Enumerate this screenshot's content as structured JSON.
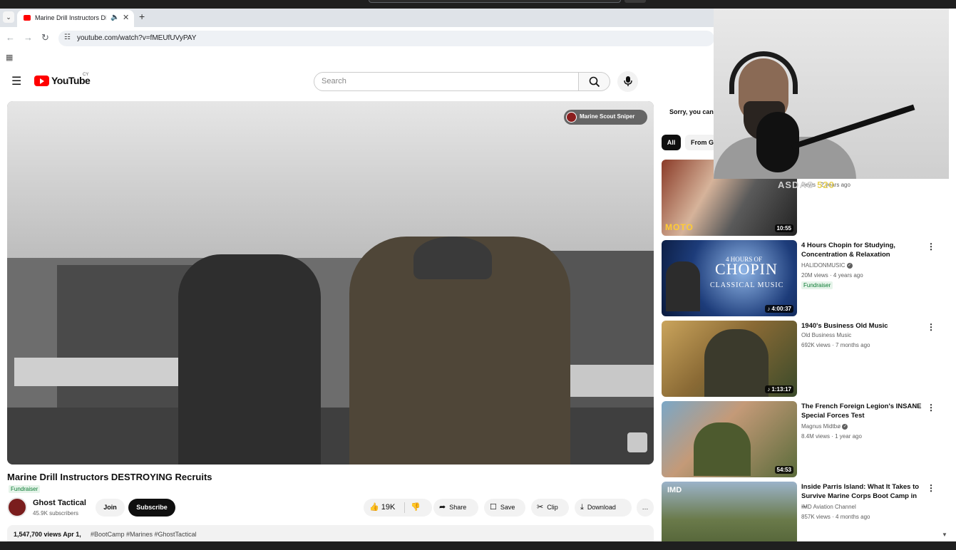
{
  "browser": {
    "tab_title": "Marine Drill Instructors DES",
    "tab_list_icon": "chevron-down",
    "speaker_glyph": "🔈",
    "close_glyph": "✕",
    "new_tab_glyph": "+",
    "url": "youtube.com/watch?v=fMEUfUVyPAY",
    "back_glyph": "←",
    "forward_glyph": "→",
    "reload_glyph": "↻",
    "tune_glyph": "☷",
    "apps_glyph": "▦"
  },
  "yt": {
    "logo_text": "YouTube",
    "country_code": "CY",
    "menu_glyph": "☰",
    "search_placeholder": "Search",
    "search_glyph": "⚲",
    "mic_glyph": "●"
  },
  "video": {
    "channel_badge": "Marine Scout Sniper",
    "title": "Marine Drill Instructors DESTROYING Recruits",
    "fundraiser": "Fundraiser",
    "channel_name": "Ghost Tactical",
    "subscribers": "45.9K subscribers",
    "join_label": "Join",
    "subscribe_label": "Subscribe",
    "like_count": "19K",
    "like_glyph": "👍",
    "dislike_glyph": "👎",
    "share_label": "Share",
    "share_glyph": "➦",
    "save_label": "Save",
    "save_glyph": "☐",
    "clip_label": "Clip",
    "clip_glyph": "✂",
    "download_label": "Download",
    "download_glyph": "⤓",
    "more_glyph": "…",
    "stats": "1,547,700 views  Apr 1,",
    "hashtags": "#BootCamp #Marines #GhostTactical"
  },
  "sidebar": {
    "sorry_text": "Sorry, you can'",
    "chips": [
      "All",
      "From G"
    ],
    "overlay_text": "ASDAS",
    "overlay_number": "520",
    "overlay_meta": "views · 2 years ago",
    "recommendations": [
      {
        "thumb_label": "MOTO",
        "duration": "10:55",
        "title": "",
        "channel": "",
        "meta": "",
        "fundraiser": ""
      },
      {
        "thumb_label": "4 HOURS OF",
        "thumb_big": "CHOPIN",
        "thumb_sub": "CLASSICAL MUSIC",
        "duration": "♪ 4:00:37",
        "title": "4 Hours Chopin for Studying, Concentration & Relaxation",
        "channel": "HALIDONMUSIC",
        "meta": "20M views · 4 years ago",
        "fundraiser": "Fundraiser"
      },
      {
        "thumb_label": "",
        "duration": "♪ 1:13:17",
        "title": "1940's Business Old Music",
        "channel": "Old Business Music",
        "meta": "692K views · 7 months ago",
        "fundraiser": ""
      },
      {
        "thumb_label": "",
        "duration": "54:53",
        "title": "The French Foreign Legion's INSANE Special Forces Test",
        "channel": "Magnus Midtbø",
        "meta": "8.4M views · 1 year ago",
        "fundraiser": ""
      },
      {
        "thumb_label": "IMD",
        "duration": "",
        "title": "Inside Parris Island: What It Takes to Survive Marine Corps Boot Camp in ...",
        "channel": "IMD Aviation Channel",
        "meta": "857K views · 4 months ago",
        "fundraiser": ""
      }
    ],
    "kebab_glyph": "⋮",
    "verified_glyph": "✓"
  },
  "scroll_down_glyph": "▼"
}
